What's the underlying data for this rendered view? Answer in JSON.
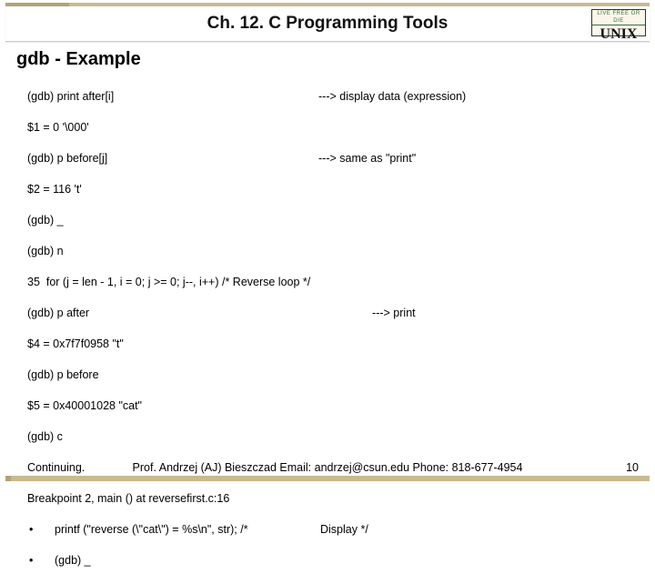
{
  "header": {
    "chapter_title": "Ch. 12. C Programming Tools",
    "badge_top": "LIVE FREE OR DIE",
    "badge_main": "UNIX"
  },
  "section_heading": "gdb - Example",
  "code": {
    "l01_left": "(gdb) print after[i]",
    "l01_right": "---> display data (expression)",
    "l02": "$1 = 0 '\\000'",
    "l03_left": "(gdb) p before[j]",
    "l03_right": "---> same as \"print\"",
    "l04": "$2 = 116 't'",
    "l05": "(gdb) _",
    "l06": "(gdb) n",
    "l07": "35  for (j = len - 1, i = 0; j >= 0; j--, i++) /* Reverse loop */",
    "l08_left": "(gdb) p after",
    "l08_right": "                 ---> print",
    "l09": "$4 = 0x7f7f0958 \"t\"",
    "l10": "(gdb) p before",
    "l11": "$5 = 0x40001028 \"cat\"",
    "l12": "(gdb) c",
    "l13": "Continuing.",
    "l14": "Breakpoint 2, main () at reversefirst.c:16",
    "b1_left": "printf (\"reverse (\\\"cat\\\") = %s\\n\", str); /*",
    "b1_right": "Display */",
    "b2": "(gdb) _"
  },
  "footer": {
    "attribution": "Prof. Andrzej (AJ) Bieszczad Email: andrzej@csun.edu Phone: 818-677-4954",
    "page_number": "10"
  }
}
